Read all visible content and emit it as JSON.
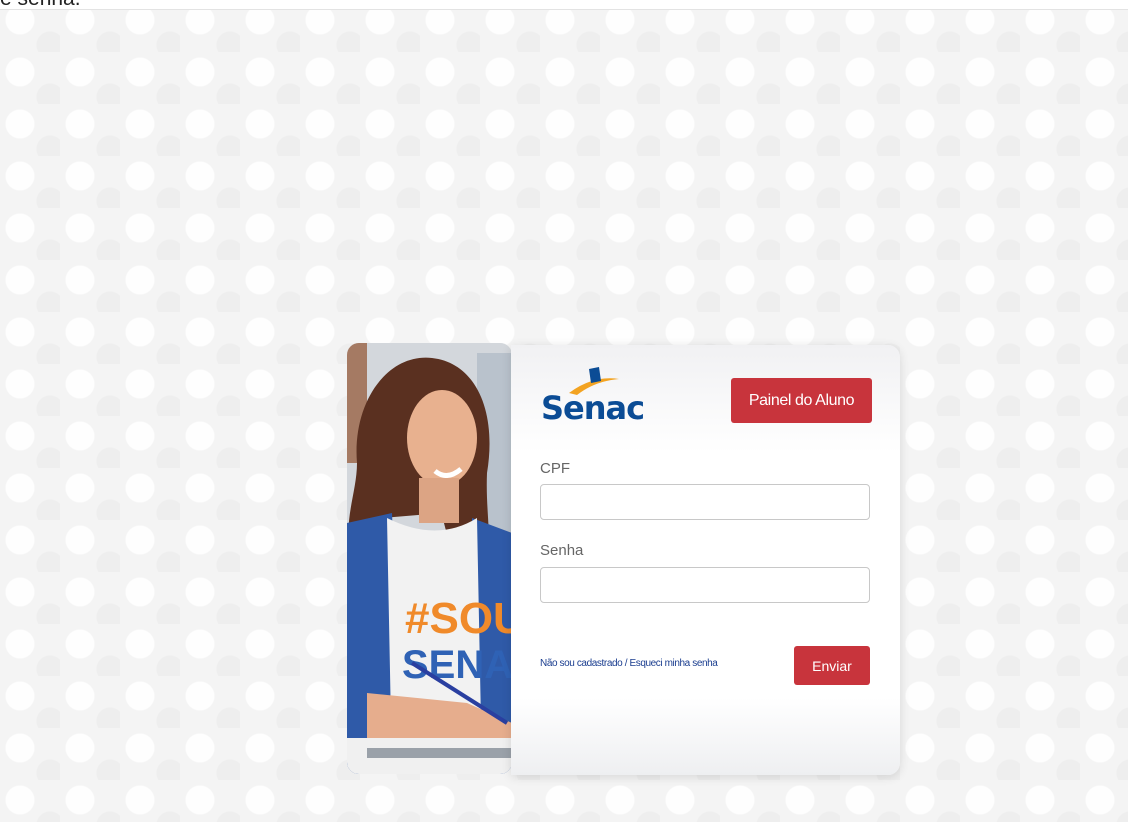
{
  "top_strip": {
    "text": "e senha."
  },
  "login": {
    "photo": {
      "shirt_text_line1": "#SOU",
      "shirt_text_line2": "SENAC",
      "icon": "student-photo"
    },
    "logo": {
      "text": "Senac",
      "icon": "senac-logo-icon",
      "colors": {
        "blue": "#0b4c95",
        "orange": "#f3a321"
      }
    },
    "panel_button": "Painel do Aluno",
    "cpf": {
      "label": "CPF",
      "value": "",
      "placeholder": ""
    },
    "senha": {
      "label": "Senha",
      "value": "",
      "placeholder": ""
    },
    "links": {
      "register": "Não sou cadastrado",
      "separator": " / ",
      "forgot": "Esqueci minha senha"
    },
    "submit_button": "Enviar"
  },
  "colors": {
    "accent": "#c8343c",
    "link": "#1a3d8f",
    "background": "#f4f4f4"
  }
}
